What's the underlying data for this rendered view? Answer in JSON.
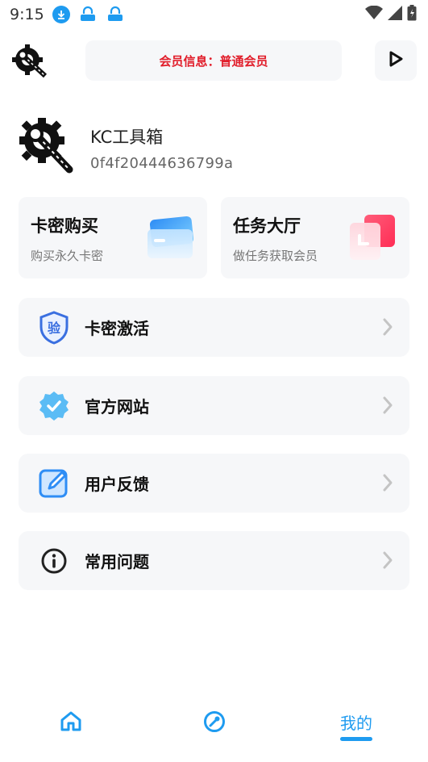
{
  "status_bar": {
    "time": "9:15"
  },
  "header": {
    "member_info": "会员信息：普通会员"
  },
  "profile": {
    "name": "KC工具箱",
    "id": "0f4f20444636799a"
  },
  "cards": [
    {
      "title": "卡密购买",
      "subtitle": "购买永久卡密"
    },
    {
      "title": "任务大厅",
      "subtitle": "做任务获取会员"
    }
  ],
  "menu": [
    {
      "label": "卡密激活",
      "icon": "shield-verify-icon"
    },
    {
      "label": "官方网站",
      "icon": "verified-badge-icon"
    },
    {
      "label": "用户反馈",
      "icon": "edit-icon"
    },
    {
      "label": "常用问题",
      "icon": "info-icon"
    }
  ],
  "menu_icon_text": "验",
  "bottom_nav": {
    "mine_label": "我的"
  },
  "colors": {
    "accent": "#1e9bf0",
    "member_text": "#e11d2a",
    "card_bg": "#f6f7f9"
  }
}
